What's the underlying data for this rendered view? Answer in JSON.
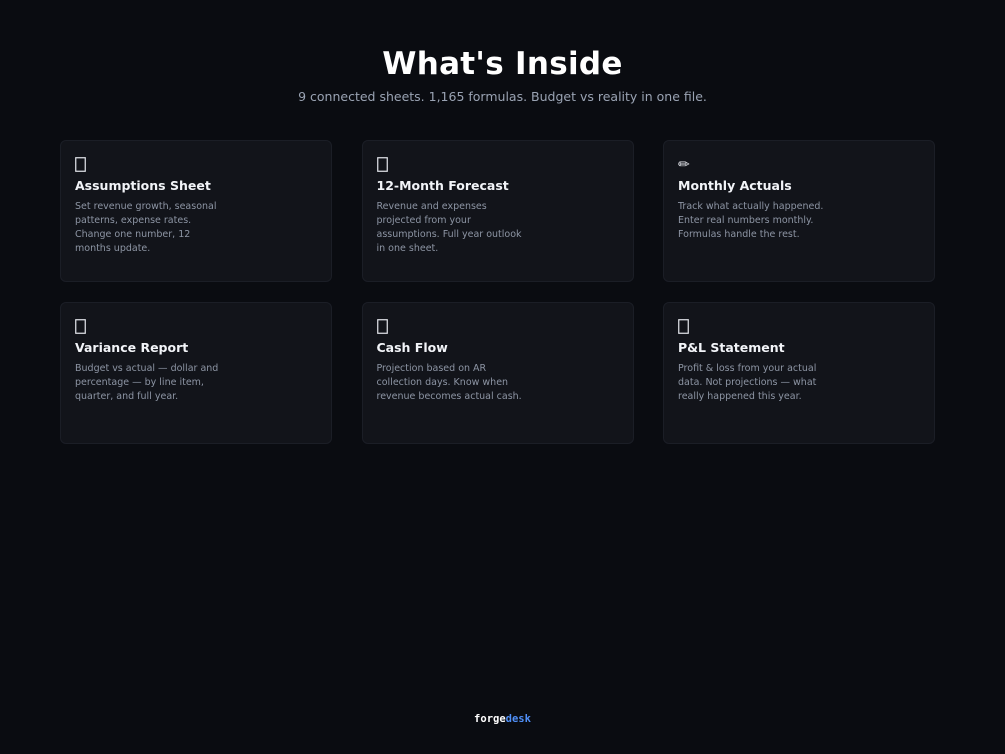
{
  "header": {
    "title": "What's Inside",
    "subtitle": "9 connected sheets. 1,165 formulas. Budget vs reality in one file."
  },
  "cards": [
    {
      "icon": "tofu-box-icon",
      "title": "Assumptions Sheet",
      "description": "Set revenue growth, seasonal patterns, expense rates. Change one number, 12 months update."
    },
    {
      "icon": "tofu-box-icon",
      "title": "12-Month Forecast",
      "description": "Revenue and expenses projected from your assumptions. Full year outlook in one sheet."
    },
    {
      "icon": "pencil-icon",
      "icon_glyph": "✏",
      "title": "Monthly Actuals",
      "description": "Track what actually happened. Enter real numbers monthly. Formulas handle the rest."
    },
    {
      "icon": "tofu-box-icon",
      "title": "Variance Report",
      "description": "Budget vs actual — dollar and percentage — by line item, quarter, and full year."
    },
    {
      "icon": "tofu-box-icon",
      "title": "Cash Flow",
      "description": "Projection based on AR collection days. Know when revenue becomes actual cash."
    },
    {
      "icon": "tofu-box-icon",
      "title": "P&L Statement",
      "description": "Profit & loss from your actual data. Not projections — what really happened this year."
    }
  ],
  "footer": {
    "brand_part1": "forge",
    "brand_part2": "desk"
  },
  "colors": {
    "background": "#0a0c11",
    "card_background": "#12141a",
    "accent": "#4f8ff7"
  }
}
